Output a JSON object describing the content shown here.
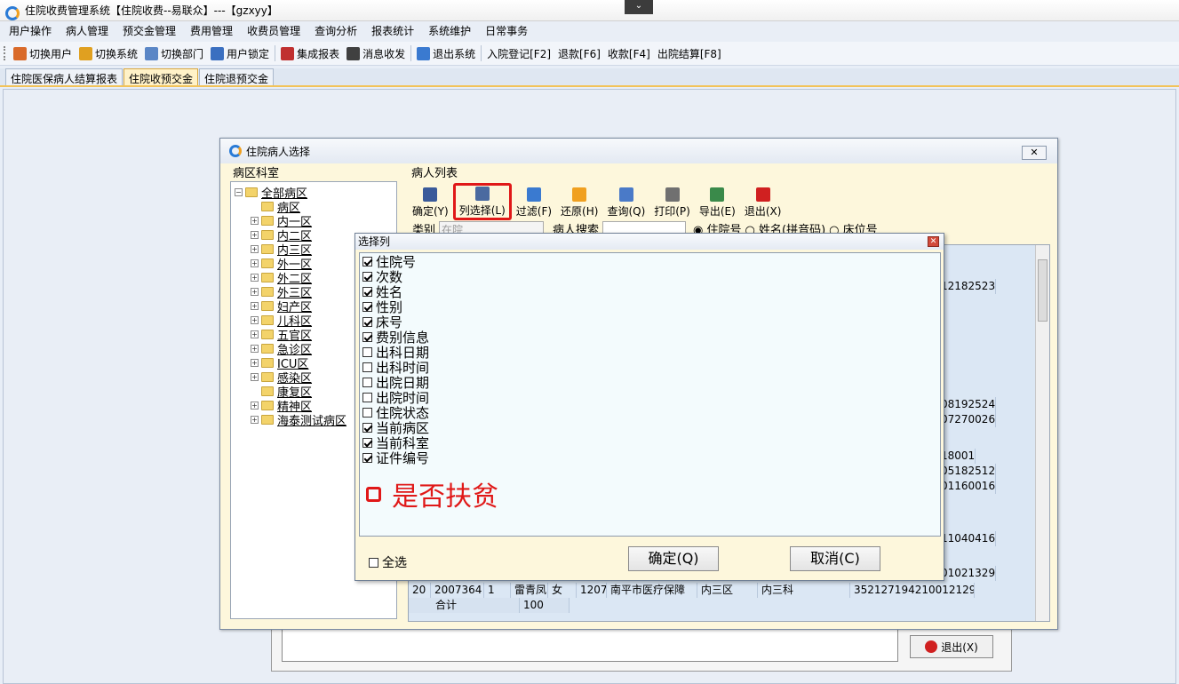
{
  "window": {
    "title": "住院收费管理系统【住院收费--易联众】---【gzxyy】",
    "collapse_glyph": "⌄"
  },
  "menu": [
    "用户操作",
    "病人管理",
    "预交金管理",
    "费用管理",
    "收费员管理",
    "查询分析",
    "报表统计",
    "系统维护",
    "日常事务"
  ],
  "toolbar": [
    {
      "label": "切换用户",
      "icon": "switch-user-icon",
      "color": "#d96a2a"
    },
    {
      "label": "切换系统",
      "icon": "switch-system-icon",
      "color": "#e0a020"
    },
    {
      "label": "切换部门",
      "icon": "switch-dept-icon",
      "color": "#5a86c6"
    },
    {
      "label": "用户锁定",
      "icon": "user-lock-icon",
      "color": "#3a6fc0"
    },
    {
      "label": "集成报表",
      "icon": "report-icon",
      "color": "#c03030"
    },
    {
      "label": "消息收发",
      "icon": "message-icon",
      "color": "#404040"
    },
    {
      "label": "退出系统",
      "icon": "exit-system-icon",
      "color": "#3a7ad0"
    },
    {
      "label": "入院登记[F2]",
      "icon": "",
      "color": ""
    },
    {
      "label": "退款[F6]",
      "icon": "",
      "color": ""
    },
    {
      "label": "收款[F4]",
      "icon": "",
      "color": ""
    },
    {
      "label": "出院结算[F8]",
      "icon": "",
      "color": ""
    }
  ],
  "tabs": [
    {
      "label": "住院医保病人结算报表",
      "active": false
    },
    {
      "label": "住院收预交金",
      "active": true
    },
    {
      "label": "住院退预交金",
      "active": false
    }
  ],
  "background_panel": {
    "exit_label": "退出(X)"
  },
  "patient_window": {
    "title": "住院病人选择",
    "close_glyph": "✕",
    "ward_header": "病区科室",
    "list_header": "病人列表",
    "ward_tree": [
      {
        "label": "全部病区",
        "expander": "−",
        "root": true
      },
      {
        "label": "病区",
        "expander": ""
      },
      {
        "label": "内一区",
        "expander": "+"
      },
      {
        "label": "内二区",
        "expander": "+"
      },
      {
        "label": "内三区",
        "expander": "+"
      },
      {
        "label": "外一区",
        "expander": "+"
      },
      {
        "label": "外二区",
        "expander": "+"
      },
      {
        "label": "外三区",
        "expander": "+"
      },
      {
        "label": "妇产区",
        "expander": "+"
      },
      {
        "label": "儿科区",
        "expander": "+"
      },
      {
        "label": "五官区",
        "expander": "+"
      },
      {
        "label": "急诊区",
        "expander": "+"
      },
      {
        "label": "ICU区",
        "expander": "+"
      },
      {
        "label": "感染区",
        "expander": "+"
      },
      {
        "label": "康复区",
        "expander": ""
      },
      {
        "label": "精神区",
        "expander": "+"
      },
      {
        "label": "海泰测试病区",
        "expander": "+"
      }
    ],
    "tools": [
      {
        "label": "确定(Y)",
        "icon": "confirm-icon",
        "color": "#3a5a9a"
      },
      {
        "label": "列选择(L)",
        "icon": "column-select-icon",
        "color": "#4a6aa0",
        "highlight": true
      },
      {
        "label": "过滤(F)",
        "icon": "filter-icon",
        "color": "#3a7ad0"
      },
      {
        "label": "还原(H)",
        "icon": "restore-icon",
        "color": "#f0a020"
      },
      {
        "label": "查询(Q)",
        "icon": "query-icon",
        "color": "#4a7ac8"
      },
      {
        "label": "打印(P)",
        "icon": "print-icon",
        "color": "#707070"
      },
      {
        "label": "导出(E)",
        "icon": "export-icon",
        "color": "#3a8a4a"
      },
      {
        "label": "退出(X)",
        "icon": "exit-icon",
        "color": "#d02020"
      }
    ],
    "filter": {
      "category_label": "类别",
      "category_value": "在院",
      "search_label": "病人搜索",
      "radio_inpatient": "住院号",
      "radio_name": "姓名(拼音码)",
      "radio_bed": "床位号"
    },
    "grid": {
      "row20": {
        "no": "20",
        "inpatient_no": "2007364",
        "visits": "1",
        "name": "雷青凤",
        "sex": "女",
        "bed": "1207",
        "fee_type": "南平市医疗保障",
        "ward": "内三区",
        "dept": "内三科",
        "id_no": "352127194210012129"
      },
      "total_label": "合计",
      "total_value": "100",
      "id_tails": [
        "12182523",
        "08192524",
        "07270026",
        "18001",
        "05182512",
        "01160016",
        "11040416",
        "01021329"
      ]
    }
  },
  "column_dialog": {
    "title": "选择列",
    "close_glyph": "✕",
    "columns": [
      {
        "label": "住院号",
        "checked": true
      },
      {
        "label": "次数",
        "checked": true
      },
      {
        "label": "姓名",
        "checked": true
      },
      {
        "label": "性别",
        "checked": true
      },
      {
        "label": "床号",
        "checked": true
      },
      {
        "label": "费别信息",
        "checked": true
      },
      {
        "label": "出科日期",
        "checked": false
      },
      {
        "label": "出科时间",
        "checked": false
      },
      {
        "label": "出院日期",
        "checked": false
      },
      {
        "label": "出院时间",
        "checked": false
      },
      {
        "label": "住院状态",
        "checked": false
      },
      {
        "label": "当前病区",
        "checked": true
      },
      {
        "label": "当前科室",
        "checked": true
      },
      {
        "label": "证件编号",
        "checked": true
      }
    ],
    "poverty_label": "是否扶贫",
    "select_all_label": "全选",
    "ok_label": "确定(Q)",
    "cancel_label": "取消(C)"
  }
}
